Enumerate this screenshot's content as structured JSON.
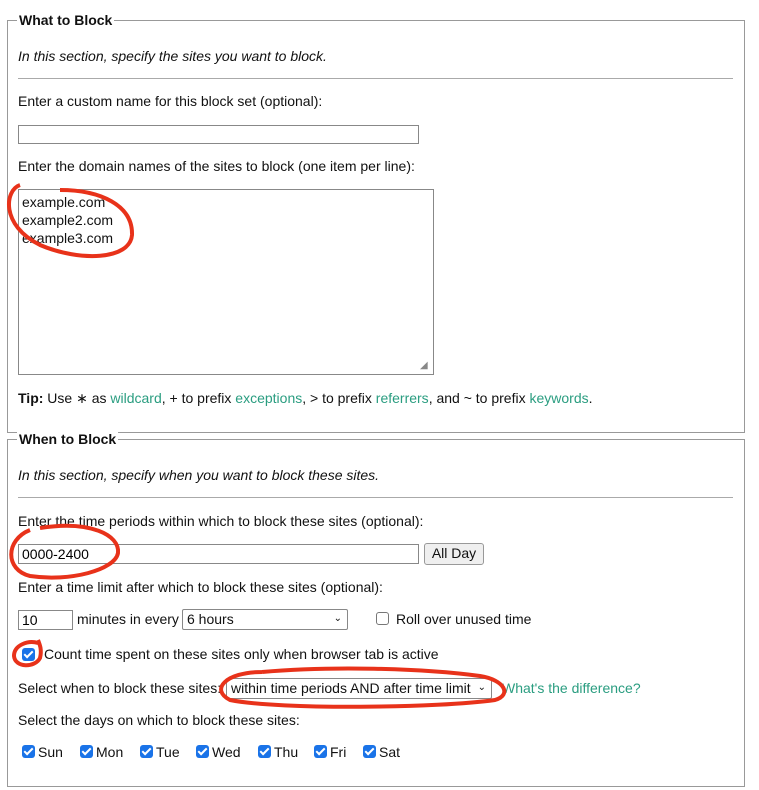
{
  "what": {
    "legend": "What to Block",
    "intro": "In this section, specify the sites you want to block.",
    "name_label": "Enter a custom name for this block set (optional):",
    "name_value": "",
    "sites_label": "Enter the domain names of the sites to block (one item per line):",
    "sites_value": "example.com\nexample2.com\nexample3.com",
    "tip": {
      "bold": "Tip:",
      "t1": " Use ∗ as ",
      "wildcard": "wildcard",
      "t2": ", + to prefix ",
      "exceptions": "exceptions",
      "t3": ", > to prefix ",
      "referrers": "referrers",
      "t4": ", and ~ to prefix ",
      "keywords": "keywords",
      "t5": "."
    }
  },
  "when": {
    "legend": "When to Block",
    "intro": "In this section, specify when you want to block these sites.",
    "periods_label": "Enter the time periods within which to block these sites (optional):",
    "periods_value": "0000-2400",
    "all_day": "All Day",
    "limit_label": "Enter a time limit after which to block these sites (optional):",
    "limit_minutes": "10",
    "minutes_in_every": "minutes in every",
    "period_select": "6 hours",
    "rollover_label": "Roll over unused time",
    "rollover_checked": false,
    "active_tab_label": "Count time spent on these sites only when browser tab is active",
    "active_tab_checked": true,
    "mode_label": "Select when to block these sites:",
    "mode_select": "within time periods AND after time limit",
    "difference_link": "What's the difference?",
    "days_label": "Select the days on which to block these sites:",
    "days": [
      {
        "label": "Sun",
        "checked": true
      },
      {
        "label": "Mon",
        "checked": true
      },
      {
        "label": "Tue",
        "checked": true
      },
      {
        "label": "Wed",
        "checked": true
      },
      {
        "label": "Thu",
        "checked": true
      },
      {
        "label": "Fri",
        "checked": true
      },
      {
        "label": "Sat",
        "checked": true
      }
    ]
  },
  "colors": {
    "link": "#2a9d80",
    "checkbox": "#1a73e8",
    "annotation": "#e8321a"
  }
}
